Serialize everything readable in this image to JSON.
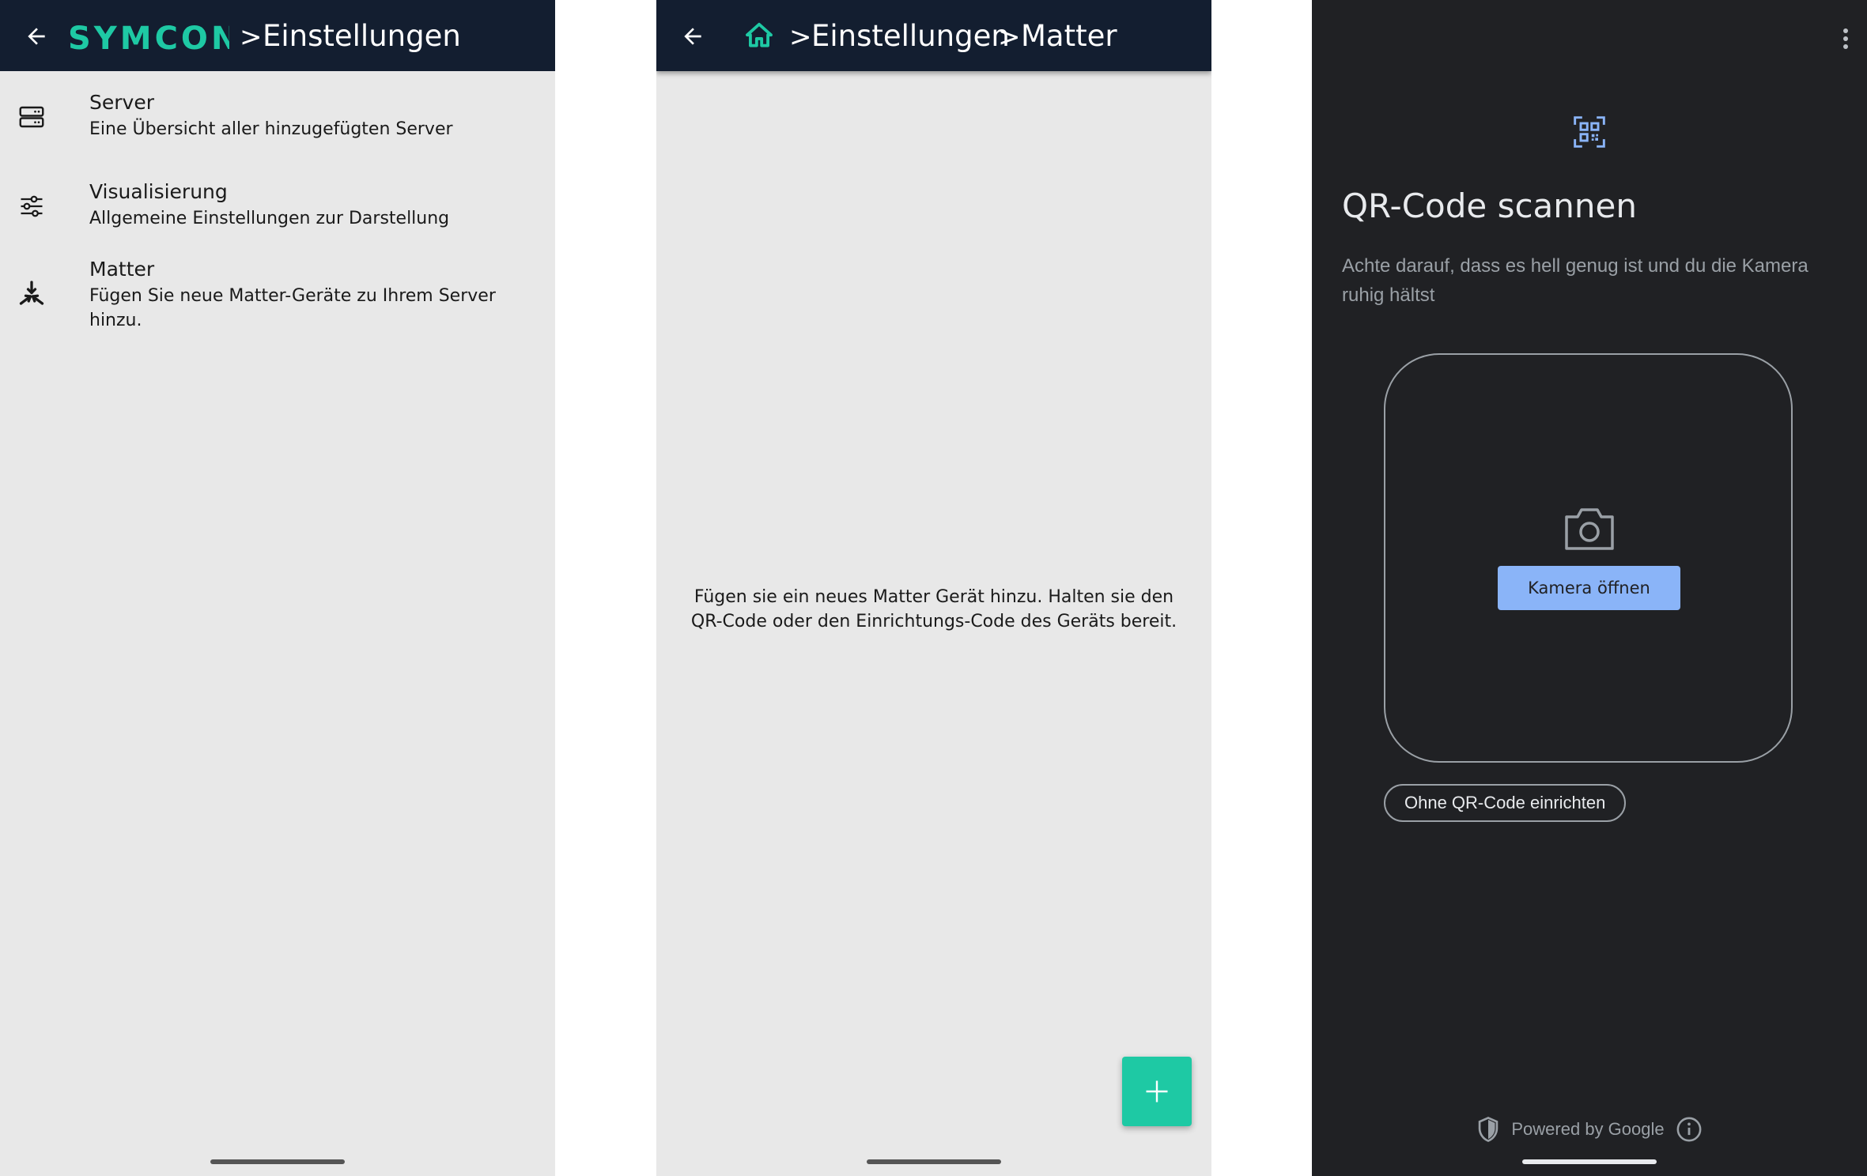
{
  "screen1": {
    "app_logo_text": "SYMCON",
    "breadcrumb_sep": ">",
    "title": "Einstellungen",
    "items": [
      {
        "icon": "server-icon",
        "title": "Server",
        "subtitle": "Eine Übersicht aller hinzugefügten Server"
      },
      {
        "icon": "sliders-icon",
        "title": "Visualisierung",
        "subtitle": "Allgemeine Einstellungen zur Darstellung"
      },
      {
        "icon": "matter-icon",
        "title": "Matter",
        "subtitle": "Fügen Sie neue Matter-Geräte zu Ihrem Server hinzu."
      }
    ]
  },
  "screen2": {
    "breadcrumb_sep": ">",
    "crumbs": [
      "Einstellungen",
      "Matter"
    ],
    "empty_message": "Fügen sie ein neues Matter Gerät hinzu. Halten sie den QR-Code oder den Einrichtungs-Code des Geräts bereit.",
    "fab_icon": "plus-icon"
  },
  "screen3": {
    "title": "QR-Code scannen",
    "subtitle": "Achte darauf, dass es hell genug ist und du die Kamera ruhig hältst",
    "open_camera_label": "Kamera öffnen",
    "no_qr_label": "Ohne QR-Code einrichten",
    "powered_by": "Powered by Google"
  },
  "colors": {
    "appbar_bg": "#131e30",
    "brand_teal": "#1ec9a4",
    "light_bg": "#e8e8e8",
    "dark_bg": "#202124",
    "google_blue": "#8ab4f8"
  }
}
